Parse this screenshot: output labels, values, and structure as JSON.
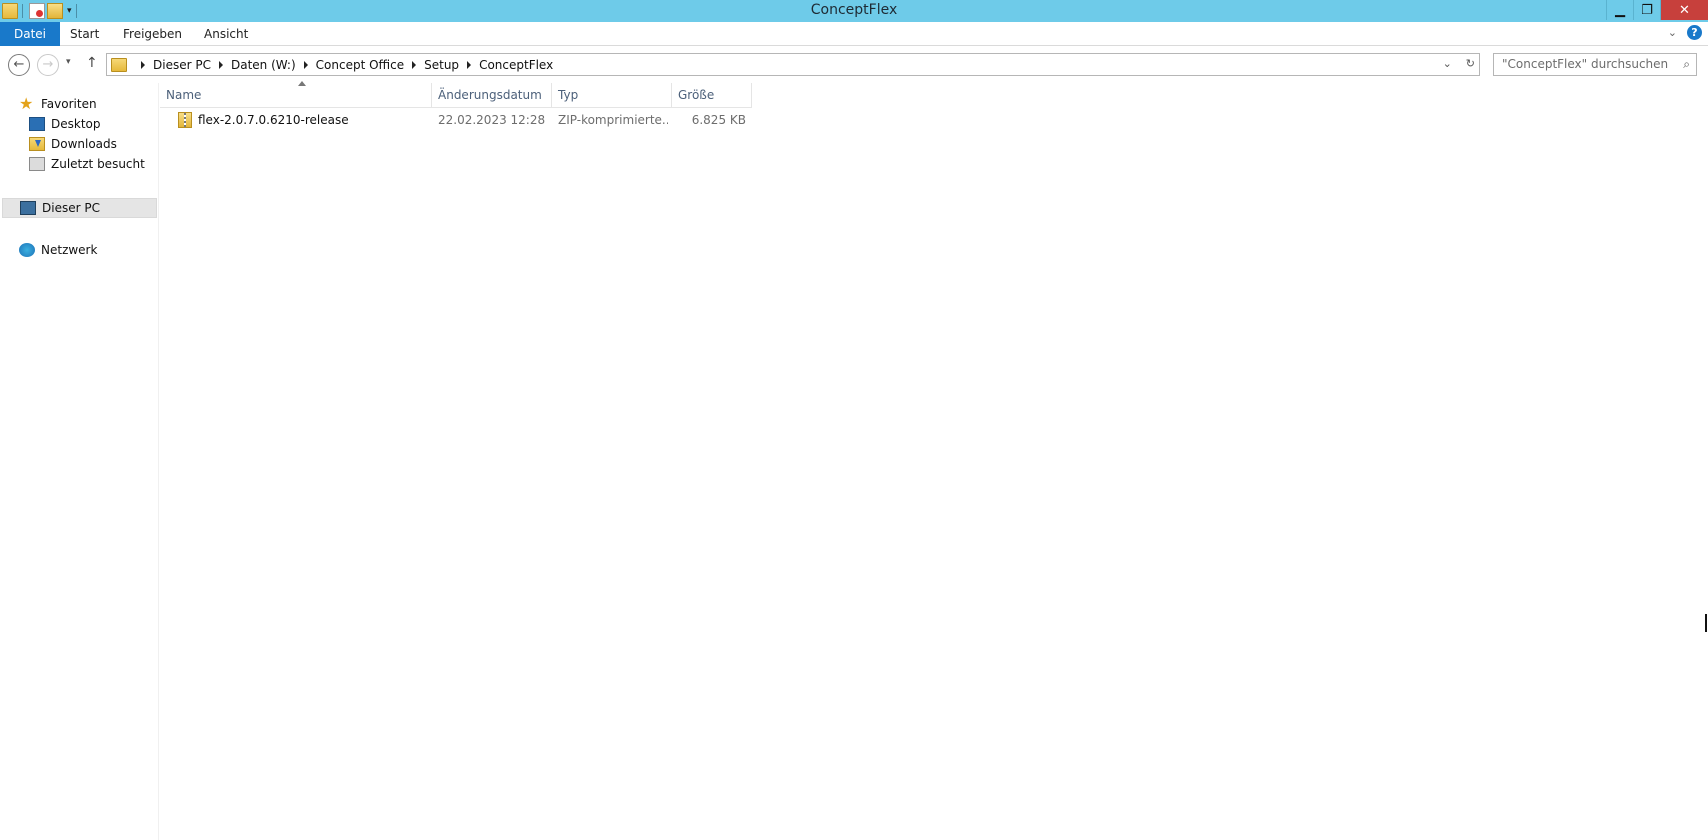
{
  "window": {
    "title": "ConceptFlex"
  },
  "quick_access": {
    "icons": [
      "folder-icon",
      "properties-icon",
      "new-folder-icon",
      "customize-dropdown-icon"
    ]
  },
  "window_controls": {
    "minimize": "▁",
    "restore": "❐",
    "close": "✕"
  },
  "ribbon": {
    "tabs": [
      {
        "label": "Datei"
      },
      {
        "label": "Start"
      },
      {
        "label": "Freigeben"
      },
      {
        "label": "Ansicht"
      }
    ],
    "help": "?"
  },
  "nav": {
    "back": "←",
    "forward": "→",
    "recent_dropdown": "▾",
    "up": "↑"
  },
  "address": {
    "crumbs": [
      "Dieser PC",
      "Daten (W:)",
      "Concept Office",
      "Setup",
      "ConceptFlex"
    ],
    "dropdown": "⌄",
    "refresh": "↻"
  },
  "search": {
    "placeholder": "\"ConceptFlex\" durchsuchen",
    "icon": "⌕"
  },
  "sidebar": {
    "favorites": "Favoriten",
    "items": [
      {
        "label": "Desktop",
        "icon": "desktop-icon"
      },
      {
        "label": "Downloads",
        "icon": "downloads-icon"
      },
      {
        "label": "Zuletzt besucht",
        "icon": "recent-places-icon"
      }
    ],
    "this_pc": "Dieser PC",
    "network": "Netzwerk"
  },
  "files": {
    "columns": [
      "Name",
      "Änderungsdatum",
      "Typ",
      "Größe"
    ],
    "rows": [
      {
        "name": "flex-2.0.7.0.6210-release",
        "date": "22.02.2023 12:28",
        "type": "ZIP-komprimierte...",
        "size": "6.825 KB"
      }
    ]
  }
}
